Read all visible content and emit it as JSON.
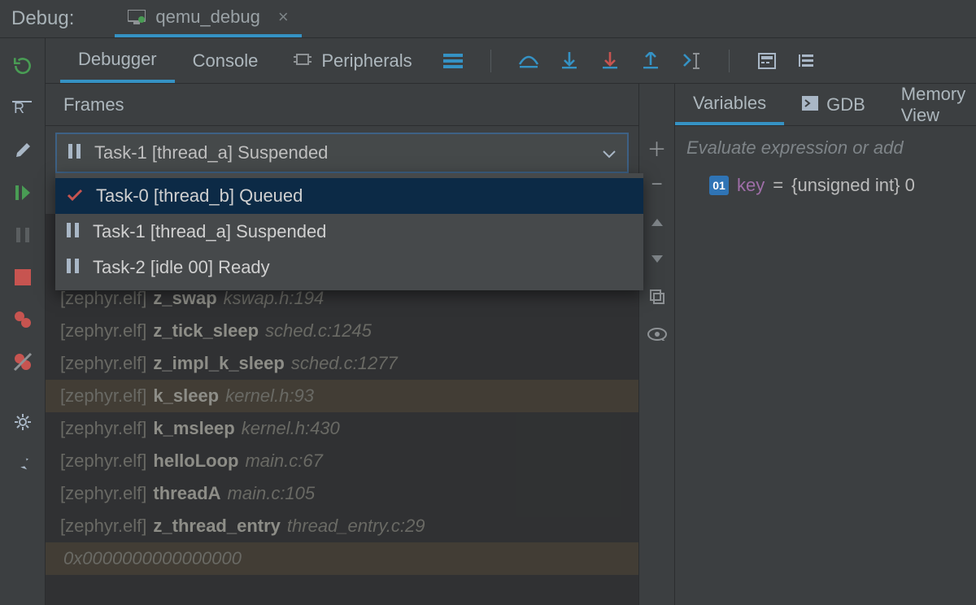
{
  "top": {
    "label": "Debug:",
    "run_config": "qemu_debug"
  },
  "toolbar": {
    "tabs": {
      "debugger": "Debugger",
      "console": "Console",
      "peripherals": "Peripherals"
    }
  },
  "frames": {
    "header": "Frames",
    "selected_thread": "Task-1 [thread_a] Suspended",
    "dropdown": [
      {
        "label": "Task-0 [thread_b] Queued",
        "icon": "check",
        "selected": true
      },
      {
        "label": "Task-1 [thread_a] Suspended",
        "icon": "suspend",
        "selected": false
      },
      {
        "label": "Task-2 [idle 00] Ready",
        "icon": "suspend",
        "selected": false
      }
    ],
    "stack": [
      {
        "elf": "[zephyr.elf]",
        "fn": "z_swap",
        "loc": "kswap.h:194",
        "lib": false
      },
      {
        "elf": "[zephyr.elf]",
        "fn": "z_tick_sleep",
        "loc": "sched.c:1245",
        "lib": false
      },
      {
        "elf": "[zephyr.elf]",
        "fn": "z_impl_k_sleep",
        "loc": "sched.c:1277",
        "lib": false
      },
      {
        "elf": "[zephyr.elf]",
        "fn": "k_sleep",
        "loc": "kernel.h:93",
        "lib": true
      },
      {
        "elf": "[zephyr.elf]",
        "fn": "k_msleep",
        "loc": "kernel.h:430",
        "lib": false
      },
      {
        "elf": "[zephyr.elf]",
        "fn": "helloLoop",
        "loc": "main.c:67",
        "lib": false
      },
      {
        "elf": "[zephyr.elf]",
        "fn": "threadA",
        "loc": "main.c:105",
        "lib": false
      },
      {
        "elf": "[zephyr.elf]",
        "fn": "z_thread_entry",
        "loc": "thread_entry.c:29",
        "lib": false
      }
    ],
    "tail_addr": "0x0000000000000000"
  },
  "vars": {
    "tabs": {
      "variables": "Variables",
      "gdb": "GDB",
      "memory": "Memory View"
    },
    "placeholder": "Evaluate expression or add",
    "item": {
      "badge": "01",
      "name": "key",
      "eq": "=",
      "value": "{unsigned int} 0"
    }
  }
}
